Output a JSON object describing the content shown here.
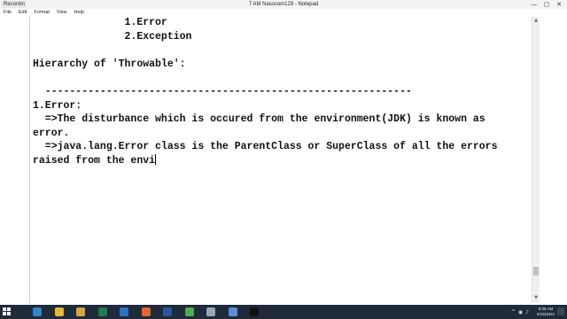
{
  "window": {
    "badge": "Recordin",
    "title": "7 AM Nasscom129 - Notepad",
    "minimize_glyph": "—",
    "maximize_glyph": "▢",
    "close_glyph": "✕"
  },
  "menu": {
    "items": [
      "File",
      "Edit",
      "Format",
      "View",
      "Help"
    ]
  },
  "editor": {
    "text": "               1.Error\n               2.Exception\n\nHierarchy of 'Throwable':\n\n  ------------------------------------------------------------\n1.Error:\n  =>The disturbance which is occured from the environment(JDK) is known as\nerror.\n  =>java.lang.Error class is the ParentClass or SuperClass of all the errors\nraised from the envi"
  },
  "scrollbar": {
    "up_glyph": "▲",
    "down_glyph": "▼"
  },
  "taskbar": {
    "icons": [
      {
        "name": "edge-icon",
        "color": "#2f86c9"
      },
      {
        "name": "file-explorer-icon",
        "color": "#e7b73a"
      },
      {
        "name": "file-manager-icon",
        "color": "#d9a441"
      },
      {
        "name": "excel-icon",
        "color": "#1f7a43"
      },
      {
        "name": "outlook-icon",
        "color": "#2a72c7"
      },
      {
        "name": "firefox-icon",
        "color": "#e7672a"
      },
      {
        "name": "word-icon",
        "color": "#2b579a"
      },
      {
        "name": "chrome-icon",
        "color": "#4caf50"
      },
      {
        "name": "settings-icon",
        "color": "#9aa7b5"
      },
      {
        "name": "photos-icon",
        "color": "#5a8fd8"
      },
      {
        "name": "cmd-icon",
        "color": "#111111"
      }
    ],
    "tray": {
      "chevron": "^",
      "network": "◉",
      "volume": "♪",
      "time": "9:06 AM",
      "date": "6/16/2022"
    }
  }
}
